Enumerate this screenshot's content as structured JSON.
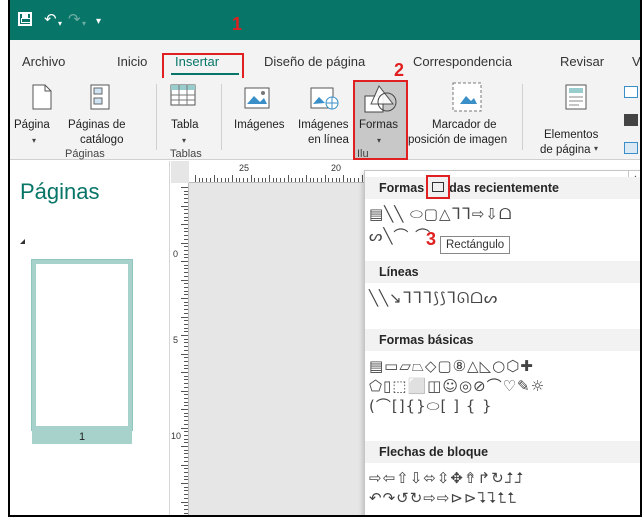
{
  "annotations": {
    "step1": "1",
    "step2": "2",
    "step3": "3"
  },
  "tabs": {
    "archivo": "Archivo",
    "inicio": "Inicio",
    "insertar": "Insertar",
    "diseno": "Diseño de página",
    "correspondencia": "Correspondencia",
    "revisar": "Revisar",
    "overflow": "V"
  },
  "ribbon": {
    "pagina": "Página",
    "paginas_catalogo_1": "Páginas de",
    "paginas_catalogo_2": "catálogo",
    "tabla": "Tabla",
    "imagenes": "Imágenes",
    "imagenes_linea_1": "Imágenes",
    "imagenes_linea_2": "en línea",
    "formas": "Formas",
    "marcador_1": "Marcador de",
    "marcador_2": "posición de imagen",
    "elementos_1": "Elementos",
    "elementos_2": "de página",
    "groups": {
      "paginas": "Páginas",
      "tablas": "Tablas",
      "ilustraciones": "Ilu"
    }
  },
  "sidebar": {
    "title": "Páginas",
    "page_number": "1"
  },
  "rulers": {
    "h25": "25",
    "h20": "20",
    "v0": "0",
    "v5": "5",
    "v10": "10"
  },
  "shapes_panel": {
    "recent_title": "Formas usadas recientemente",
    "recent_row1": "▤╲╲ ⬭▢△ᒣᒣ⇨⇩ᗝ",
    "recent_row2": "ᔕ╲⌒  ⌒ ",
    "lines_title": "Líneas",
    "lines_row": "╲╲↘ᒣᒣᒣ⟆⟆ᒣᘏᗝᔕ",
    "basic_title": "Formas básicas",
    "basic_row1": "▤▭▱⏢◇▢⑧△◺○⬡✚",
    "basic_row2": "⬠▯⬚⬜◫☺◎⊘⌒♡✎☼",
    "basic_row3": "(⌒[]{}⬭[ ] { }",
    "arrows_title": "Flechas de bloque",
    "arrows_row1": "⇨⇦⇧⇩⬄⇳✥⇮↱↻⮥⮥",
    "arrows_row2": "↶↷↺↻⇨⇨⊳⊳⮧⮧⮤⮤"
  },
  "tooltip": "Rectángulo",
  "colors": {
    "titlebar": "#077568",
    "accent_text": "#077568",
    "annotation_red": "#e02020"
  }
}
